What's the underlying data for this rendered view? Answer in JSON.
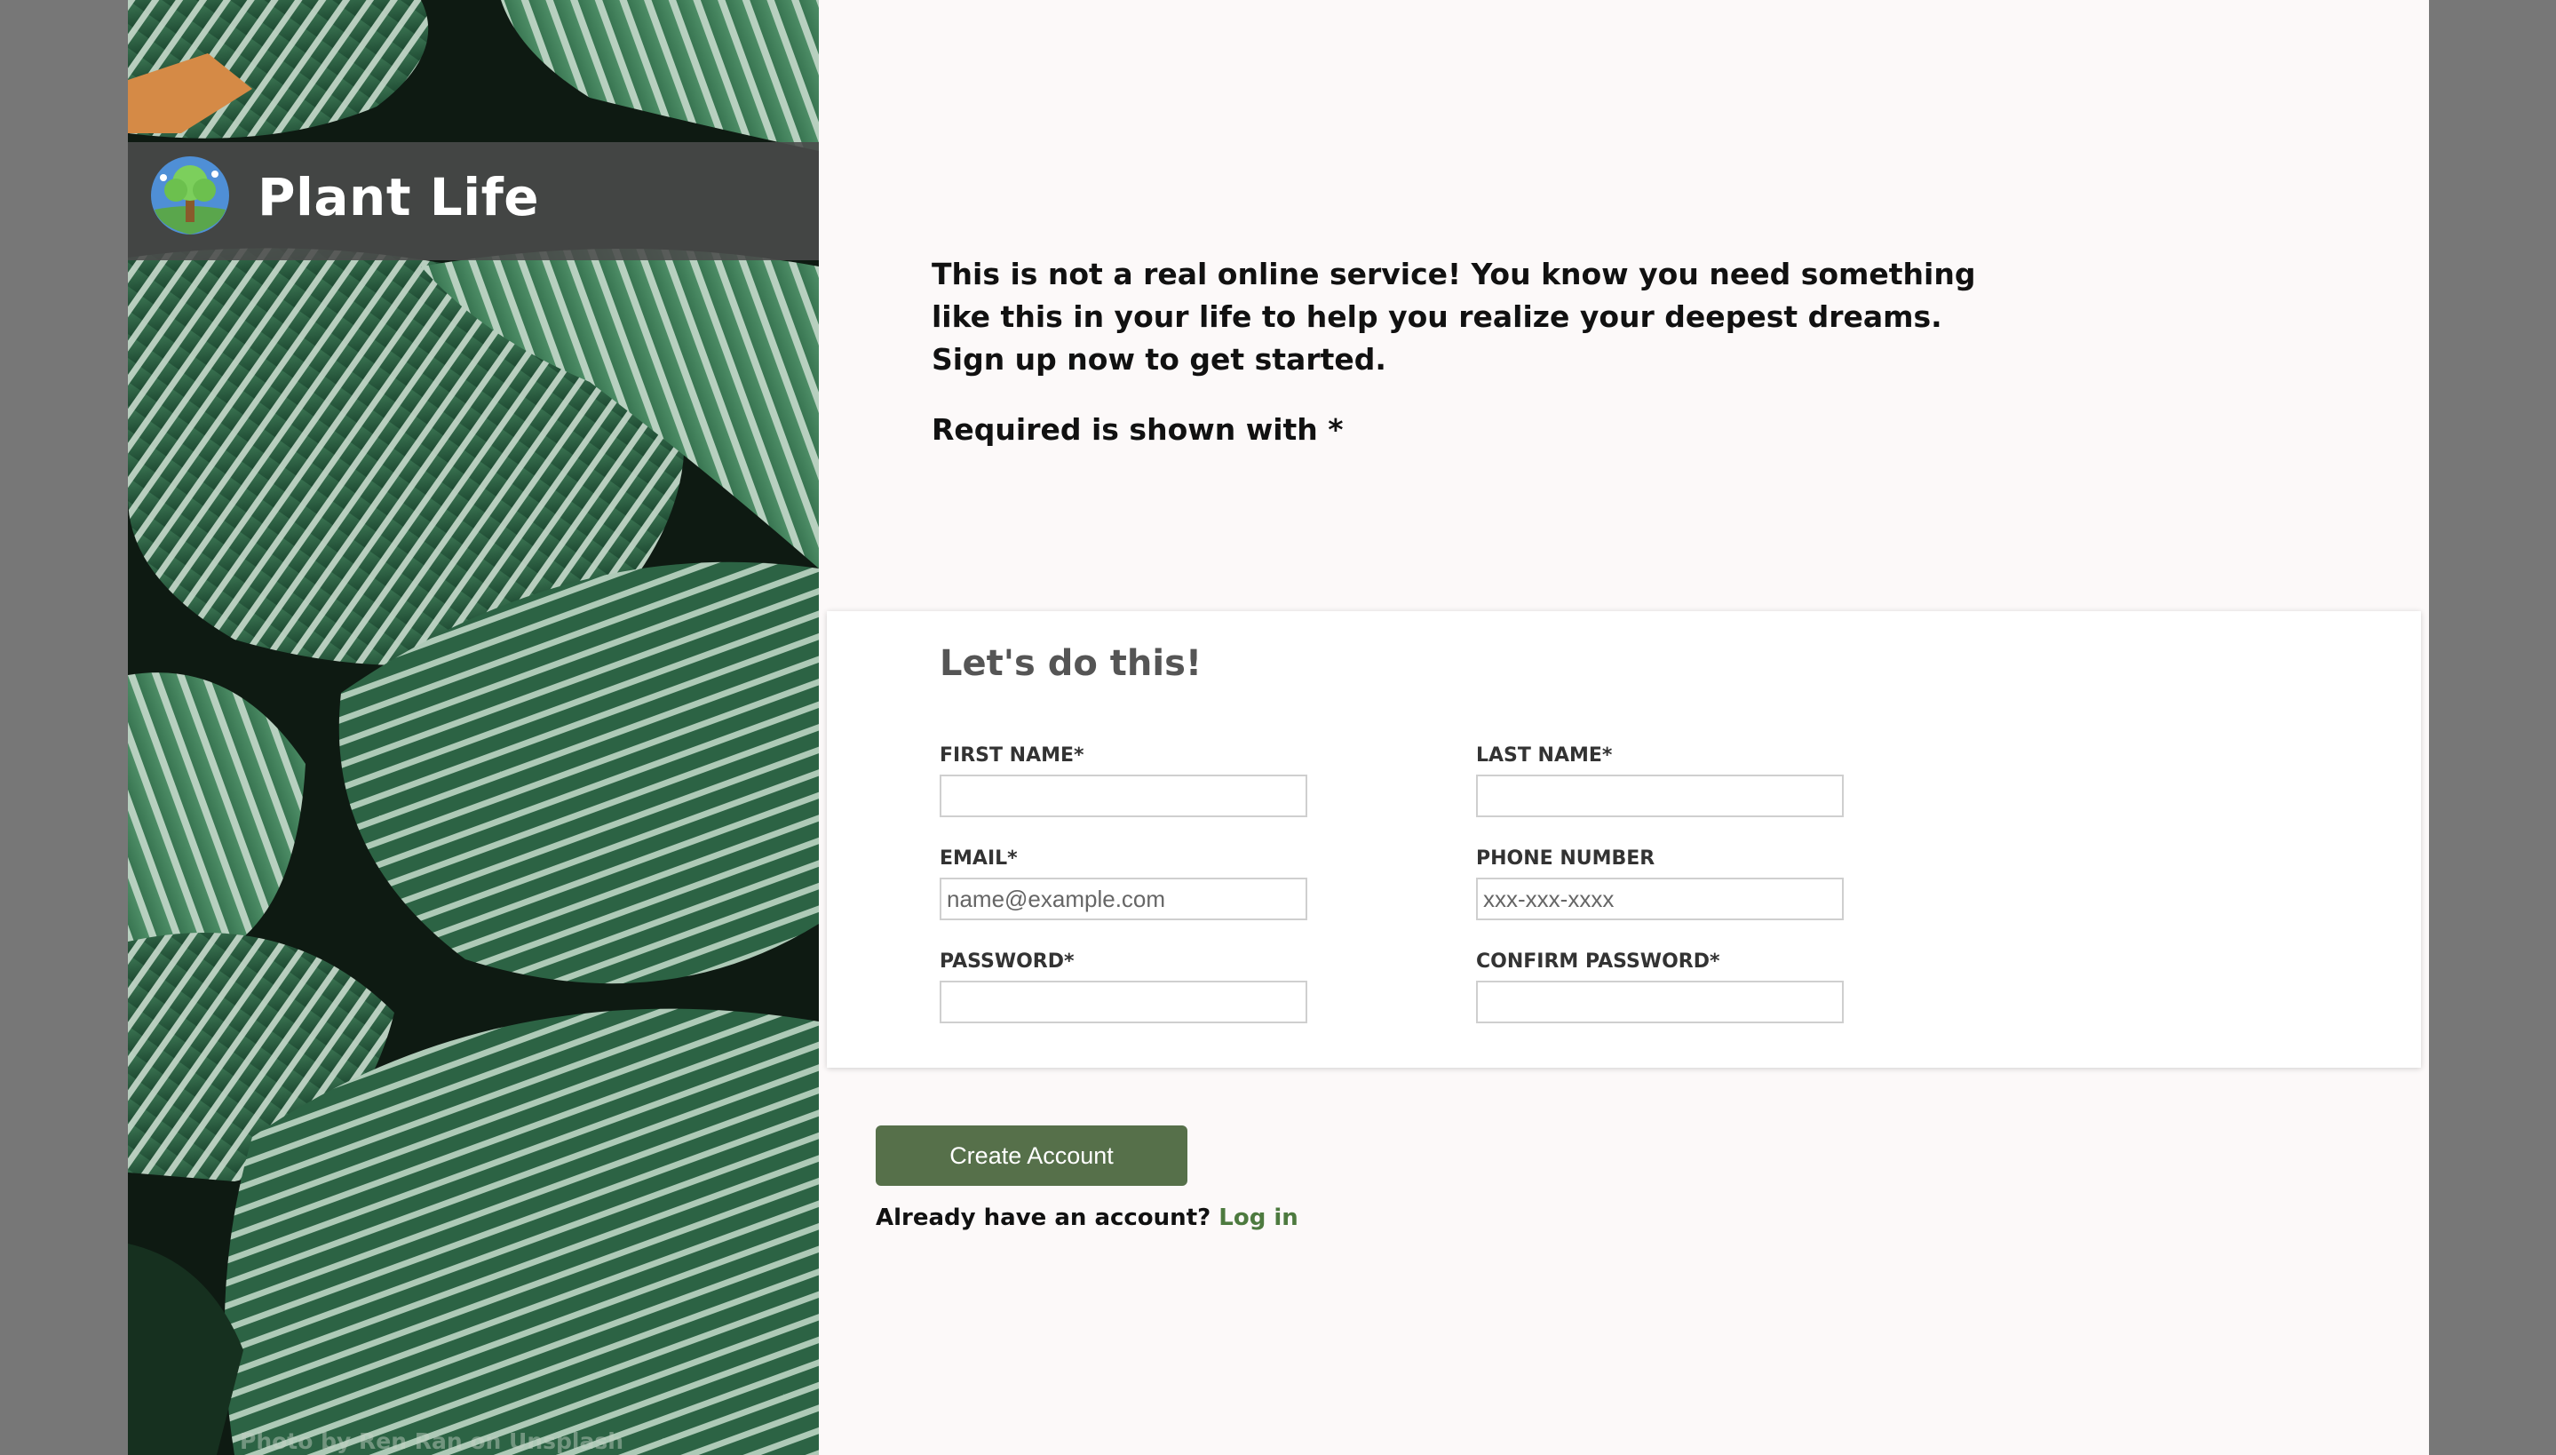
{
  "brand": {
    "name": "Plant Life",
    "logo_icon": "tree-logo-icon"
  },
  "hero": {
    "photo_credit": "Photo by Ren Ran on Unsplash"
  },
  "intro": {
    "text": "This is not a real online service! You know you need something like this in your life to help you realize your deepest dreams. Sign up now to get started.",
    "required_note": "Required is shown with *"
  },
  "form": {
    "heading": "Let's do this!",
    "fields": {
      "first_name": {
        "label": "FIRST NAME*",
        "value": "",
        "placeholder": ""
      },
      "last_name": {
        "label": "LAST NAME*",
        "value": "",
        "placeholder": ""
      },
      "email": {
        "label": "EMAIL*",
        "value": "",
        "placeholder": "name@example.com"
      },
      "phone": {
        "label": "PHONE NUMBER",
        "value": "",
        "placeholder": "xxx-xxx-xxxx"
      },
      "password": {
        "label": "PASSWORD*",
        "value": "",
        "placeholder": ""
      },
      "confirm_password": {
        "label": "CONFIRM PASSWORD*",
        "value": "",
        "placeholder": ""
      }
    }
  },
  "actions": {
    "create_account_label": "Create Account",
    "login_prompt": "Already have an account?",
    "login_link": "Log in"
  },
  "colors": {
    "background": "#777777",
    "page": "#fcf9f9",
    "accent_button": "#56704a",
    "link": "#4d7a3f",
    "brand_bar": "#4b4b4b"
  }
}
